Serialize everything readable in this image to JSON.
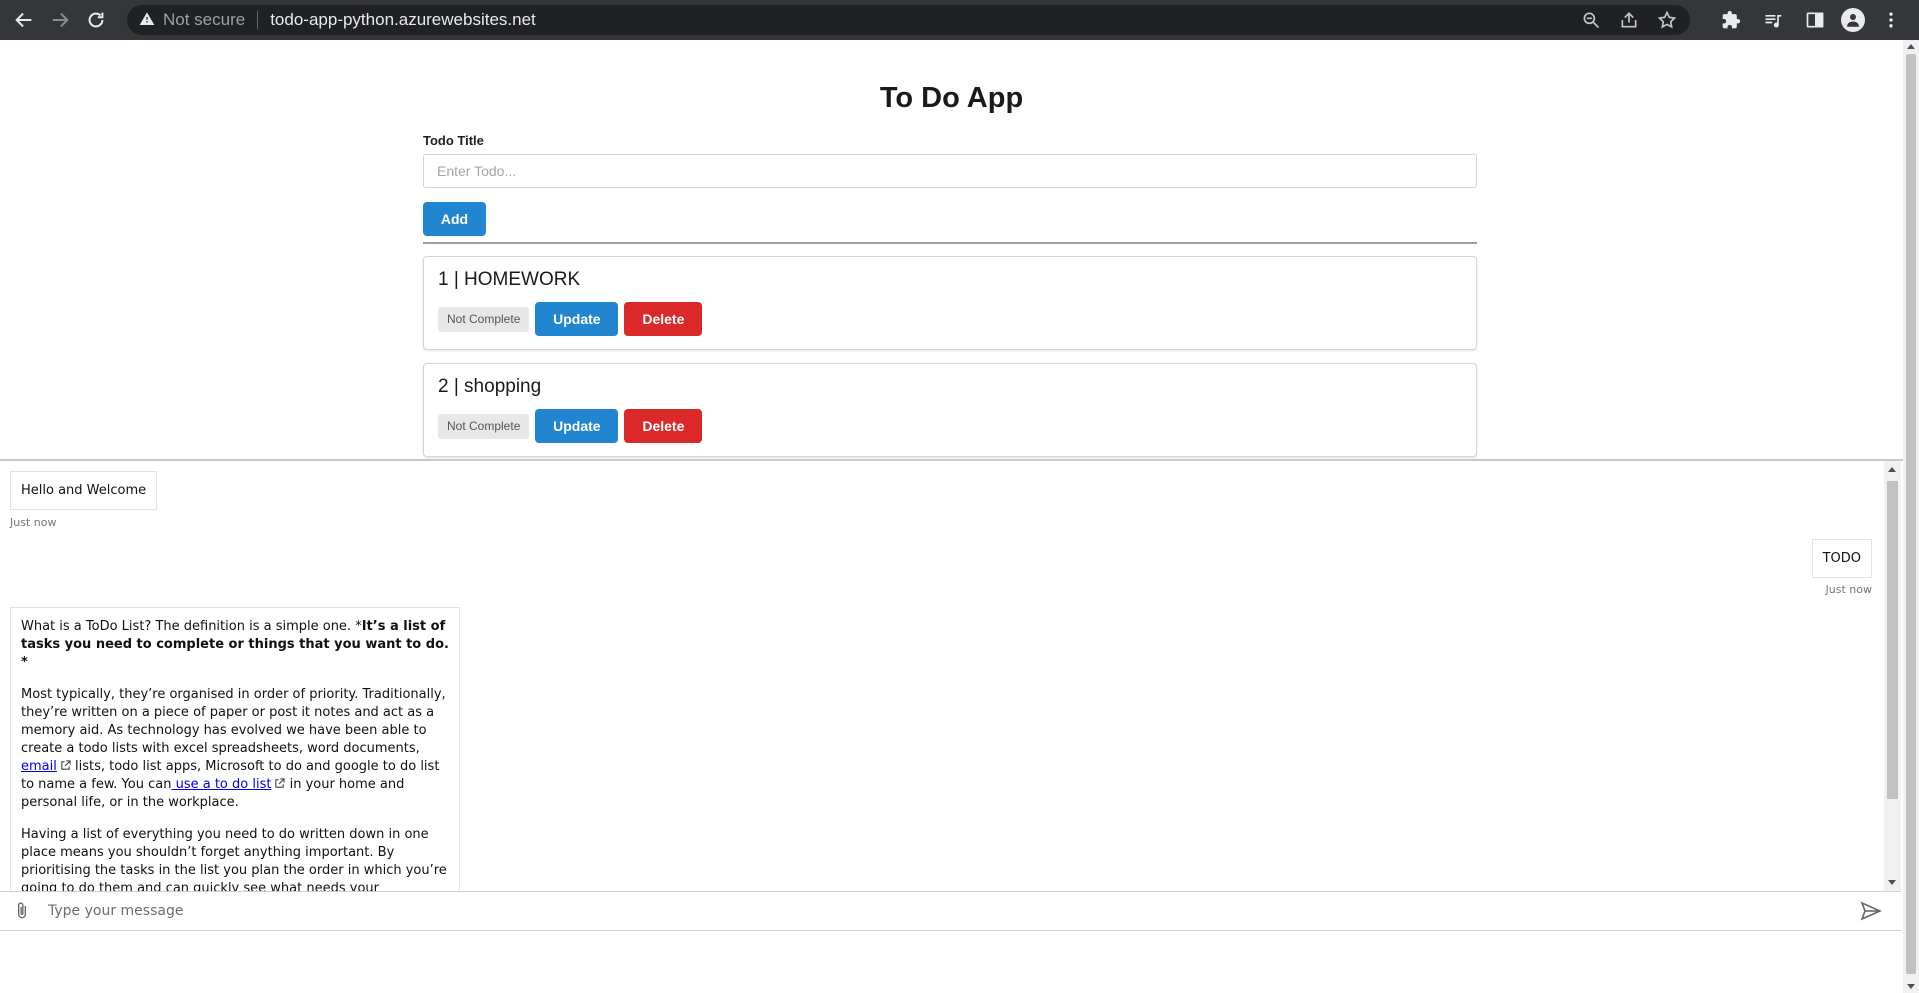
{
  "browser": {
    "security_label": "Not secure",
    "url": "todo-app-python.azurewebsites.net"
  },
  "app": {
    "title": "To Do App",
    "form": {
      "label": "Todo Title",
      "placeholder": "Enter Todo...",
      "add_label": "Add"
    },
    "todos": [
      {
        "title": "1 | HOMEWORK",
        "status": "Not Complete",
        "update_label": "Update",
        "delete_label": "Delete"
      },
      {
        "title": "2 | shopping",
        "status": "Not Complete",
        "update_label": "Update",
        "delete_label": "Delete"
      }
    ]
  },
  "chat": {
    "messages": [
      {
        "sender": "bot",
        "text": "Hello and Welcome",
        "time": "Just now"
      },
      {
        "sender": "user",
        "text": "TODO",
        "time": "Just now"
      },
      {
        "sender": "bot",
        "p1_plain": "What is a ToDo List? The definition is a simple one. *",
        "p1_bold": "It’s a list of tasks you need to complete or things that you want to do. *",
        "p2_a": "Most typically, they’re organised in order of priority. Traditionally, they’re written on a piece of paper or post it notes and act as a memory aid. As technology has evolved we have been able to create a todo lists with excel spreadsheets, word documents, ",
        "p2_link1": "email",
        "p2_b": " lists, todo list apps, Microsoft to do and google to do list to name a few. You can",
        "p2_link2": " use a to do list",
        "p2_c": " in your home and personal life, or in the workplace.",
        "p3": "Having a list of everything you need to do written down in one place means you shouldn’t forget anything important. By prioritising the tasks in the list you plan the order in which you’re going to do them and can quickly see what needs your immediate attention and what tasks you can leave until a little later."
      }
    ],
    "input_placeholder": "Type your message"
  }
}
